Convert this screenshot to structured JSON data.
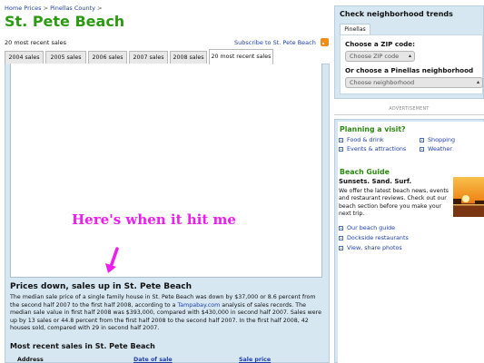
{
  "breadcrumb": {
    "home": "Home Prices",
    "sep1": ">",
    "county": "Pinellas County",
    "sep2": ">"
  },
  "page_title": "St. Pete Beach",
  "subtitle": "20 most recent sales",
  "subscribe_link": "Subscribe to St. Pete Beach",
  "tabs": [
    {
      "label": "2004 sales"
    },
    {
      "label": "2005 sales"
    },
    {
      "label": "2006 sales"
    },
    {
      "label": "2007 sales"
    },
    {
      "label": "2008 sales"
    },
    {
      "label": "20 most recent sales",
      "active": true
    }
  ],
  "annotation": {
    "text": "Here's when it hit me",
    "color": "#ee1df0"
  },
  "story": {
    "headline": "Prices down, sales up in St. Pete Beach",
    "body_1": "The median sale price of a single family house in St. Pete Beach was down by $37,000 or 8.6 percent from the second half 2007 to the first half 2008, according to a ",
    "body_link": "Tampabay.com",
    "body_2": " analysis of sales records. The median sale value in first half 2008 was $393,000, compared with $430,000 in second half 2007. Sales were up by 13 sales or 44.8 percent from the first half 2008 to the second half 2007. In the first half 2008, 42 houses sold, compared with 29 in second half 2007."
  },
  "recent_sales": {
    "heading": "Most recent sales in St. Pete Beach",
    "columns": [
      "Address",
      "Date of sale",
      "Sale price"
    ]
  },
  "sidebar": {
    "trends": {
      "title": "Check neighborhood trends",
      "tab": "Pinellas",
      "zip_label": "Choose a ZIP code:",
      "zip_select": "Choose ZIP code",
      "hood_label": "Or choose a Pinellas neighborhood",
      "hood_select": "Choose neighborhood"
    },
    "ad_label": "ADVERTISEMENT",
    "visit": {
      "heading": "Planning a visit?",
      "links": [
        "Food & drink",
        "Shopping",
        "Events & attractions",
        "Weather"
      ]
    },
    "guide": {
      "heading": "Beach Guide",
      "subheading": "Sunsets. Sand. Surf.",
      "text": "We offer the latest beach news, events and restaurant reviews. Check out our beach section before you make your next trip.",
      "links": [
        "Our beach guide",
        "Dockside restaurants",
        "View, share photos"
      ]
    }
  },
  "colors": {
    "title_green": "#2c9b12",
    "link_blue": "#1f3fa8",
    "panel_blue": "#d6e7f2",
    "annotation_magenta": "#ee1df0",
    "rss_orange": "#f28b1a"
  }
}
